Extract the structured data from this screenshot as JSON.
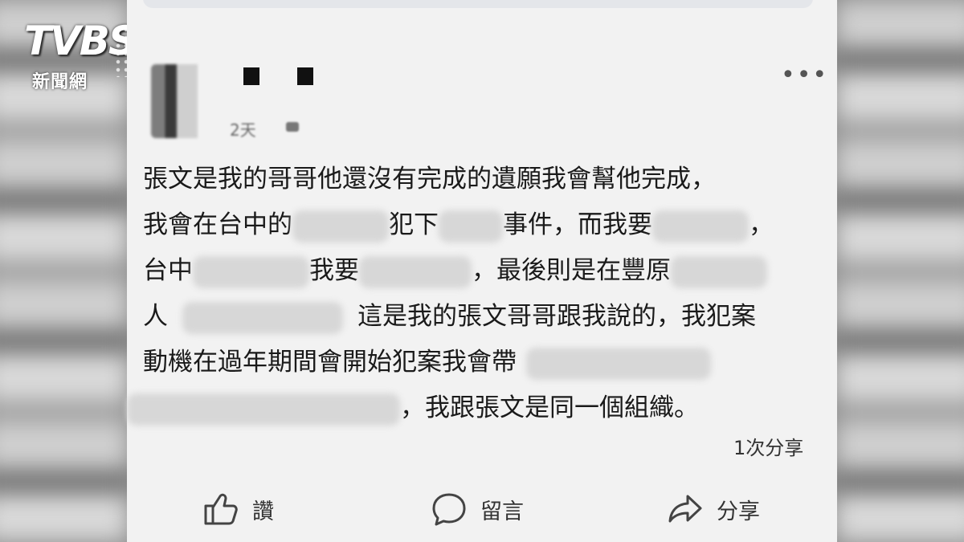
{
  "watermark": {
    "brand": "TVBS",
    "subtitle": "新聞網"
  },
  "post": {
    "timestamp": "2天",
    "lines": [
      [
        "張文是我的哥哥他還沒有完成的遺願我會幫他完成，"
      ],
      [
        "我會在台中的",
        "犯下",
        "事件，而我要",
        "，"
      ],
      [
        "台中",
        "我要",
        "，最後則是在豐原"
      ],
      [
        "人",
        "這是我的張文哥哥跟我說的，我犯案"
      ],
      [
        "動機在過年期間會開始犯案我會帶"
      ],
      [
        "，我跟張文是同一個組織。"
      ]
    ],
    "share_count": "1次分享"
  },
  "actions": {
    "like": "讚",
    "comment": "留言",
    "share": "分享"
  },
  "icons": {
    "more": "more-dots-icon",
    "like": "thumbs-up-icon",
    "comment": "comment-bubble-icon",
    "share": "share-arrow-icon",
    "audience": "audience-icon"
  }
}
